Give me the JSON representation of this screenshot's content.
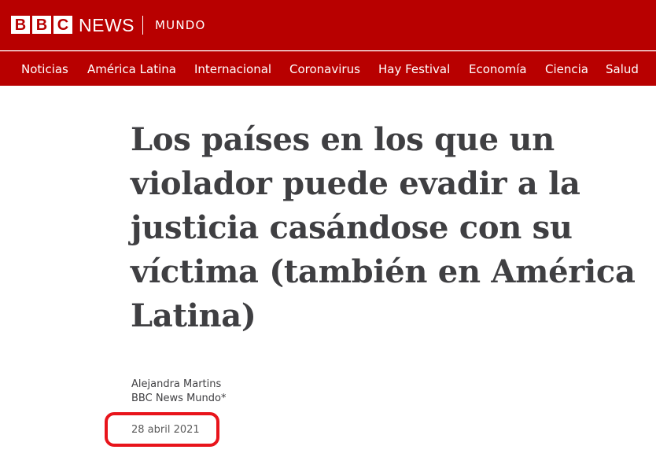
{
  "masthead": {
    "logo_letters": [
      "B",
      "B",
      "C"
    ],
    "brand": "NEWS",
    "section": "MUNDO",
    "bg_color": "#b80000"
  },
  "nav": {
    "items": [
      {
        "label": "Noticias"
      },
      {
        "label": "América Latina"
      },
      {
        "label": "Internacional"
      },
      {
        "label": "Coronavirus"
      },
      {
        "label": "Hay Festival"
      },
      {
        "label": "Economía"
      },
      {
        "label": "Ciencia"
      },
      {
        "label": "Salud"
      }
    ]
  },
  "article": {
    "headline": "Los países en los que un violador puede evadir a la justicia casándose con su víctima (también en América Latina)",
    "author": "Alejandra Martins",
    "outlet": "BBC News Mundo*",
    "date": "28 abril 2021"
  },
  "annotation": {
    "highlight_color": "#e8141b"
  }
}
